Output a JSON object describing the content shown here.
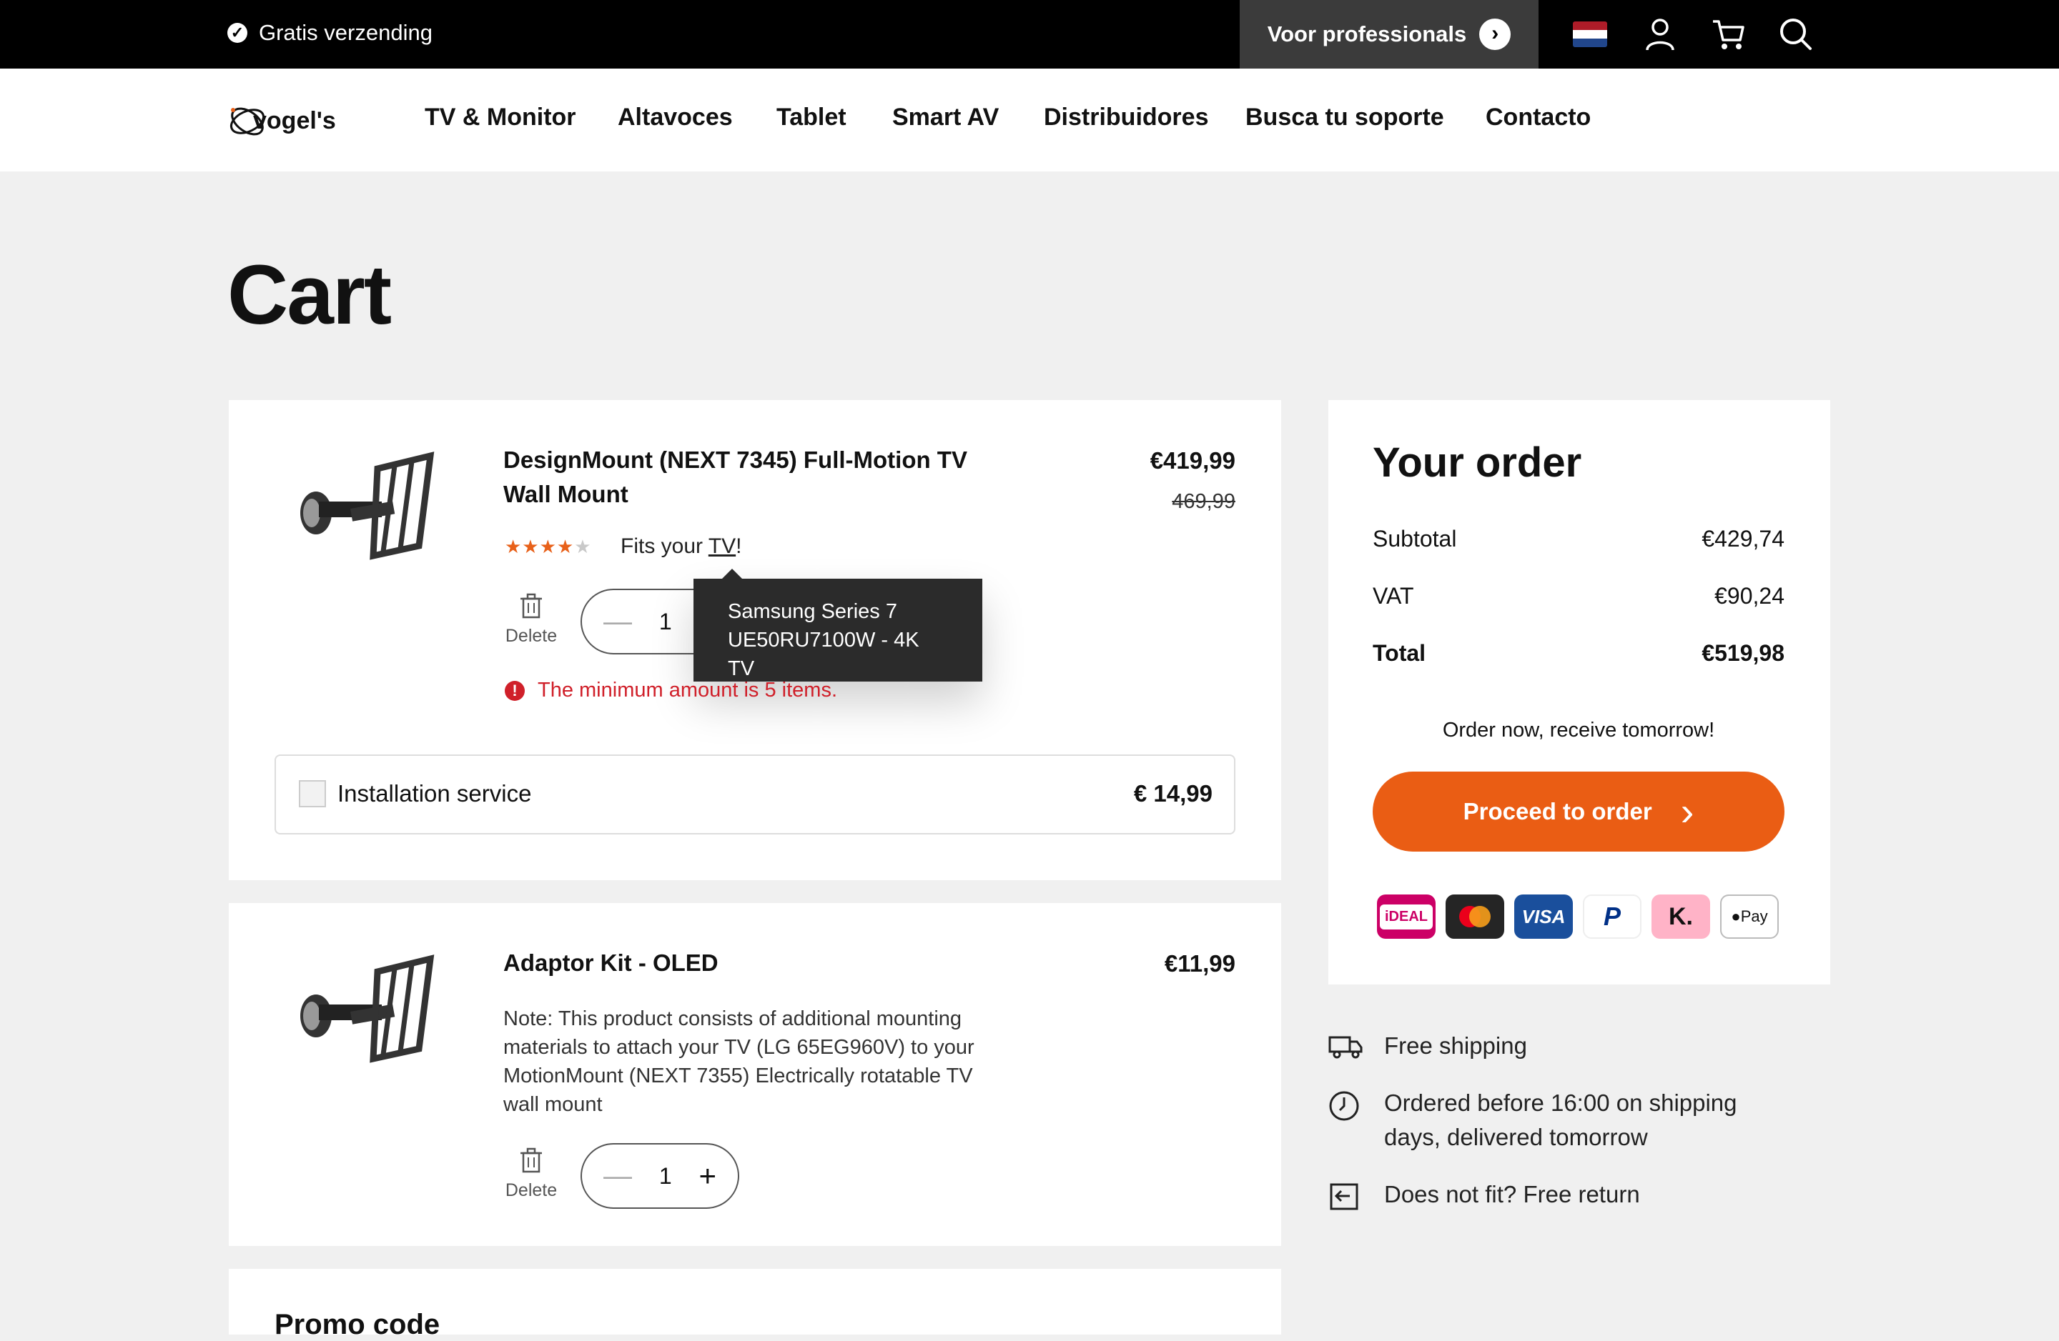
{
  "topbar": {
    "shipping": "Gratis verzending",
    "pro_label": "Voor professionals",
    "flag_colors": [
      "#ae1c28",
      "#ffffff",
      "#21468b"
    ],
    "icons": [
      "account-icon",
      "cart-icon",
      "search-icon"
    ]
  },
  "nav": {
    "logo": "vogel's",
    "items": [
      "TV & Monitor",
      "Altavoces",
      "Tablet",
      "Smart AV",
      "Distribuidores",
      "Busca tu soporte",
      "Contacto"
    ]
  },
  "page_title": "Cart",
  "cart": {
    "items": [
      {
        "name_line1": "DesignMount (NEXT 7345) Full-Motion TV",
        "name_line2": "Wall Mount",
        "price": "€419,99",
        "old_price": "469,99",
        "rating": 4,
        "rating_max": 5,
        "fits_prefix": "Fits your ",
        "fits_link": "TV",
        "fits_suffix": "!",
        "delete_label": "Delete",
        "quantity": "1",
        "tooltip_line1": "Samsung Series 7",
        "tooltip_line2": "UE50RU7100W - 4K TV",
        "error": "The minimum amount is 5 items.",
        "service_label": "Installation service",
        "service_price": "€ 14,99"
      },
      {
        "name": "Adaptor Kit - OLED",
        "price": "€11,99",
        "note_line1": "Note: This product consists of additional mounting",
        "note_line2": "materials to attach your TV (LG 65EG960V) to your",
        "note_line3": "MotionMount (NEXT 7355) Electrically rotatable TV",
        "note_line4": "wall mount",
        "delete_label": "Delete",
        "quantity": "1"
      }
    ],
    "promo_title": "Promo code"
  },
  "summary": {
    "title": "Your order",
    "subtotal_label": "Subtotal",
    "subtotal": "€429,74",
    "vat_label": "VAT",
    "vat": "€90,24",
    "total_label": "Total",
    "total": "€519,98",
    "delivery_note": "Order now, receive tomorrow!",
    "proceed_label": "Proceed to order",
    "payment_methods": [
      "iDEAL",
      "Mastercard",
      "VISA",
      "PayPal",
      "K.",
      "Pay"
    ],
    "accent_color": "#ea5d14"
  },
  "usps": [
    {
      "text": "Free shipping",
      "icon": "truck-icon"
    },
    {
      "text_line1": "Ordered before 16:00 on shipping",
      "text_line2": "days, delivered tomorrow",
      "icon": "clock-icon"
    },
    {
      "text": "Does not fit? Free return",
      "icon": "return-icon"
    }
  ]
}
